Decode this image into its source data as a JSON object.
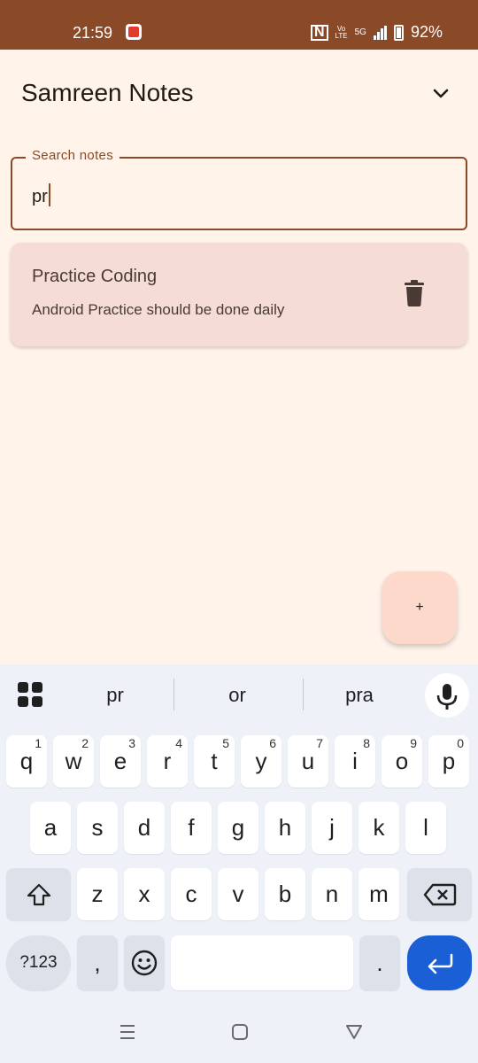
{
  "status_bar": {
    "time": "21:59",
    "network_small_top": "Vo",
    "network_small_bottom": "LTE",
    "network_type": "5G",
    "battery": "92%"
  },
  "app": {
    "title": "Samreen Notes",
    "expand_icon": "chevron-down-icon"
  },
  "search": {
    "label": "Search notes",
    "value": "pr"
  },
  "notes": [
    {
      "title": "Practice Coding",
      "body": "Android Practice should be done daily",
      "delete_icon": "trash-icon"
    }
  ],
  "fab": {
    "label": "+"
  },
  "keyboard": {
    "suggestions": [
      "pr",
      "or",
      "pra"
    ],
    "row1": [
      {
        "key": "q",
        "hint": "1"
      },
      {
        "key": "w",
        "hint": "2"
      },
      {
        "key": "e",
        "hint": "3"
      },
      {
        "key": "r",
        "hint": "4"
      },
      {
        "key": "t",
        "hint": "5"
      },
      {
        "key": "y",
        "hint": "6"
      },
      {
        "key": "u",
        "hint": "7"
      },
      {
        "key": "i",
        "hint": "8"
      },
      {
        "key": "o",
        "hint": "9"
      },
      {
        "key": "p",
        "hint": "0"
      }
    ],
    "row2": [
      "a",
      "s",
      "d",
      "f",
      "g",
      "h",
      "j",
      "k",
      "l"
    ],
    "row3": [
      "z",
      "x",
      "c",
      "v",
      "b",
      "n",
      "m"
    ],
    "symbols_label": "?123",
    "comma_label": ",",
    "period_label": "."
  },
  "colors": {
    "status_bar": "#8b4a27",
    "background": "#fff3ea",
    "card": "#f5ddd5",
    "fab": "#fdd9cc",
    "accent": "#8b4a27",
    "enter_key": "#1a5fd6"
  }
}
